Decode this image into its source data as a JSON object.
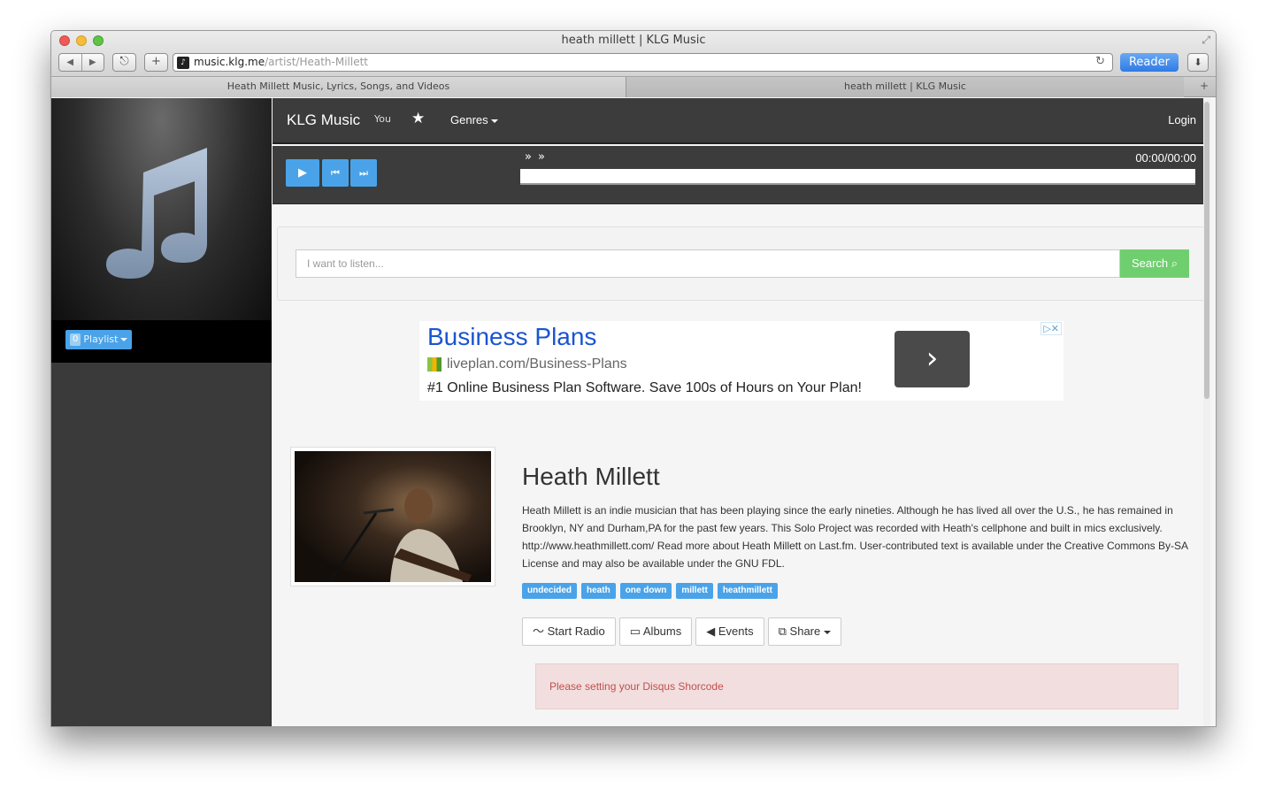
{
  "window": {
    "title": "heath millett | KLG Music",
    "url_host": "music.klg.me",
    "url_path": "/artist/Heath-Millett",
    "reader_label": "Reader",
    "tabs": [
      {
        "label": "Heath Millett Music, Lyrics, Songs, and Videos"
      },
      {
        "label": "heath millett | KLG Music"
      }
    ]
  },
  "sidebar": {
    "playlist_count": "0",
    "playlist_label": "Playlist"
  },
  "navbar": {
    "brand": "KLG Music",
    "genres_label": "Genres",
    "login_label": "Login",
    "youtube_label": "You"
  },
  "player": {
    "time": "00:00/00:00",
    "progress": 0
  },
  "search": {
    "placeholder": "I want to listen...",
    "button_label": "Search"
  },
  "ad": {
    "title": "Business Plans",
    "url": "liveplan.com/Business-Plans",
    "text": "#1 Online Business Plan Software. Save 100s of Hours on Your Plan!"
  },
  "artist": {
    "name": "Heath Millett",
    "bio": "Heath Millett is an indie musician that has been playing since the early nineties. Although he has lived all over the U.S., he has remained in Brooklyn, NY and Durham,PA for the past few years. This Solo Project was recorded with Heath's cellphone and built in mics exclusively. http://www.heathmillett.com/ Read more about Heath Millett on Last.fm. User-contributed text is available under the Creative Commons By-SA License and may also be available under the GNU FDL.",
    "tags": [
      "undecided",
      "heath",
      "one down",
      "millett",
      "heathmillett"
    ],
    "actions": {
      "radio": "Start Radio",
      "albums": "Albums",
      "events": "Events",
      "share": "Share"
    }
  },
  "disqus": {
    "message": "Please setting your Disqus Shorcode"
  },
  "colors": {
    "accent": "#4aa3e8",
    "search_button": "#6fcf6f",
    "navbar": "#3c3c3c",
    "alert_bg": "#f2dede",
    "alert_text": "#c0504d"
  }
}
